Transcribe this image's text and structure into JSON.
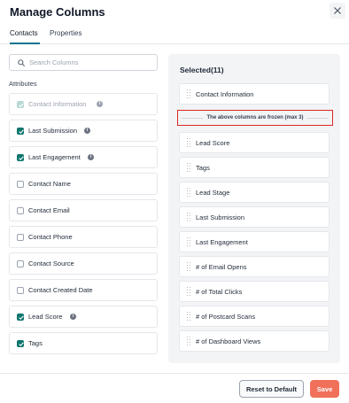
{
  "dialog": {
    "title": "Manage Columns",
    "close_icon": "close-icon"
  },
  "tabs": [
    {
      "label": "Contacts",
      "active": true
    },
    {
      "label": "Properties",
      "active": false
    }
  ],
  "search": {
    "placeholder": "Search Columns",
    "value": ""
  },
  "attributes": {
    "heading": "Attributes",
    "items": [
      {
        "label": "Contact Information",
        "checked": true,
        "disabled": true,
        "info": true
      },
      {
        "label": "Last Submission",
        "checked": true,
        "disabled": false,
        "info": true
      },
      {
        "label": "Last Engagement",
        "checked": true,
        "disabled": false,
        "info": true
      },
      {
        "label": "Contact Name",
        "checked": false,
        "disabled": false,
        "info": false
      },
      {
        "label": "Contact Email",
        "checked": false,
        "disabled": false,
        "info": false
      },
      {
        "label": "Contact Phone",
        "checked": false,
        "disabled": false,
        "info": false
      },
      {
        "label": "Contact Source",
        "checked": false,
        "disabled": false,
        "info": false
      },
      {
        "label": "Contact Created Date",
        "checked": false,
        "disabled": false,
        "info": false
      },
      {
        "label": "Lead Score",
        "checked": true,
        "disabled": false,
        "info": true
      },
      {
        "label": "Tags",
        "checked": true,
        "disabled": false,
        "info": false
      }
    ]
  },
  "selected": {
    "title": "Selected(11)",
    "frozen_note": "The above columns are frozen (max 3)",
    "items": [
      "Contact Information",
      "Lead Score",
      "Tags",
      "Lead Stage",
      "Last Submission",
      "Last Engagement",
      "# of Email Opens",
      "# of Total Clicks",
      "# of Postcard Scans",
      "# of Dashboard Views"
    ]
  },
  "footer": {
    "reset_label": "Reset to Default",
    "save_label": "Save"
  },
  "colors": {
    "accent": "#0f766e",
    "save": "#f0705a",
    "frozen_border": "#dc2626"
  }
}
